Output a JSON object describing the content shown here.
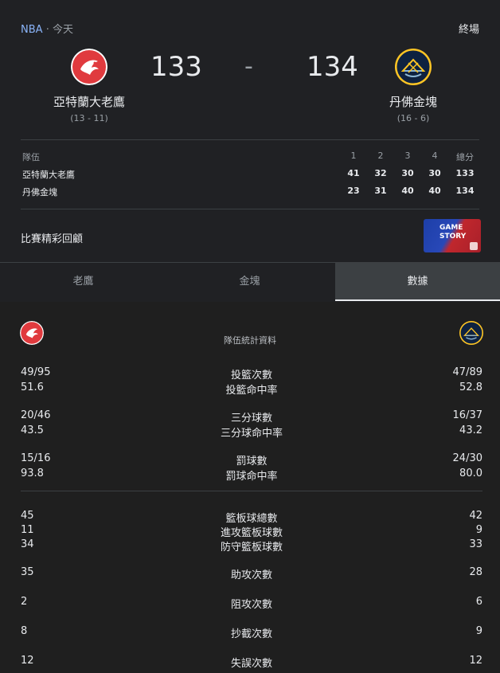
{
  "header": {
    "league": "NBA",
    "sep": "·",
    "day": "今天",
    "status": "終場"
  },
  "home": {
    "name": "亞特蘭大老鷹",
    "record": "(13 - 11)",
    "score": "133",
    "color": "#e03a3e"
  },
  "away": {
    "name": "丹佛金塊",
    "record": "(16 - 6)",
    "score": "134",
    "color": "#fec524"
  },
  "score_sep": "-",
  "linescore": {
    "headers": [
      "隊伍",
      "1",
      "2",
      "3",
      "4",
      "總分"
    ],
    "rows": [
      {
        "team": "亞特蘭大老鷹",
        "q": [
          "41",
          "32",
          "30",
          "30",
          "133"
        ]
      },
      {
        "team": "丹佛金塊",
        "q": [
          "23",
          "31",
          "40",
          "40",
          "134"
        ]
      }
    ]
  },
  "highlight": {
    "label": "比賽精彩回顧",
    "thumb_text_1": "GAME",
    "thumb_text_2": "STORY"
  },
  "tabs": [
    "老鷹",
    "金塊",
    "數據"
  ],
  "stats": {
    "title": "隊伍統計資料",
    "rows": [
      {
        "label": "投籃次數",
        "home": "49/95",
        "away": "47/89"
      },
      {
        "label": "投籃命中率",
        "home": "51.6",
        "away": "52.8"
      },
      {
        "label": "三分球數",
        "home": "20/46",
        "away": "16/37"
      },
      {
        "label": "三分球命中率",
        "home": "43.5",
        "away": "43.2"
      },
      {
        "label": "罰球數",
        "home": "15/16",
        "away": "24/30"
      },
      {
        "label": "罰球命中率",
        "home": "93.8",
        "away": "80.0"
      },
      {
        "label": "籃板球總數",
        "home": "45",
        "away": "42"
      },
      {
        "label": "進攻籃板球數",
        "home": "11",
        "away": "9"
      },
      {
        "label": "防守籃板球數",
        "home": "34",
        "away": "33"
      },
      {
        "label": "助攻次數",
        "home": "35",
        "away": "28"
      },
      {
        "label": "阻攻次數",
        "home": "2",
        "away": "6"
      },
      {
        "label": "抄截次數",
        "home": "8",
        "away": "9"
      },
      {
        "label": "失誤次數",
        "home": "12",
        "away": "12"
      }
    ]
  }
}
